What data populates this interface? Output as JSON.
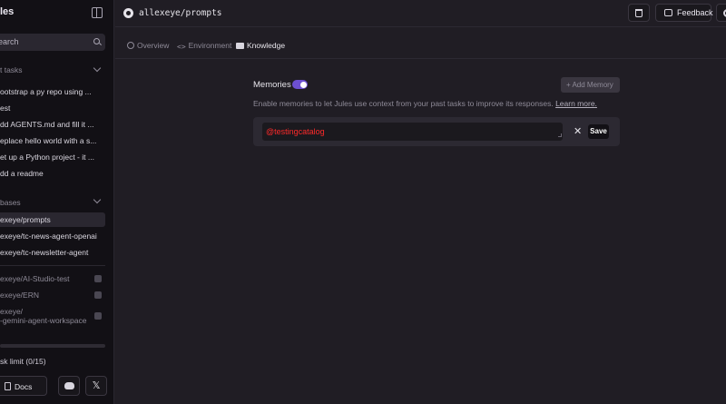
{
  "sidebar": {
    "title": "les",
    "search_placeholder": "earch",
    "tasks_heading": "t tasks",
    "tasks": [
      "ootstrap a py repo using ...",
      "est",
      "dd AGENTS.md and fill it ...",
      "eplace hello world with a s...",
      "et up a Python project - it ...",
      "dd a readme"
    ],
    "codebases_heading": "bases",
    "codebases": [
      "exeye/prompts",
      "exeye/tc-news-agent-openai",
      "exeye/tc-newsletter-agent"
    ],
    "locked_codebases": [
      "exeye/AI-Studio-test",
      "exeye/ERN"
    ],
    "locked_two_line": [
      "exeye/",
      "-gemini-agent-workspace"
    ],
    "task_limit": "sk limit (0/15)",
    "docs_label": "Docs",
    "x_label": "𝕏"
  },
  "header": {
    "repo": "allexeye/prompts",
    "feedback_label": "Feedback"
  },
  "tabs": [
    "Overview",
    "Environment",
    "Knowledge"
  ],
  "memories": {
    "label": "Memories",
    "enabled": true,
    "add_label": "+  Add Memory",
    "description": "Enable memories to let Jules use context from your past tasks to improve its responses.",
    "learn_more": "Learn more.",
    "input_value": "@testingcatalog",
    "cancel_label": "✕",
    "save_label": "Save"
  },
  "colors": {
    "accent": "#6c4fd1",
    "input_text": "#ff2a2a",
    "background": "#201d24",
    "sidebar": "#121015"
  }
}
